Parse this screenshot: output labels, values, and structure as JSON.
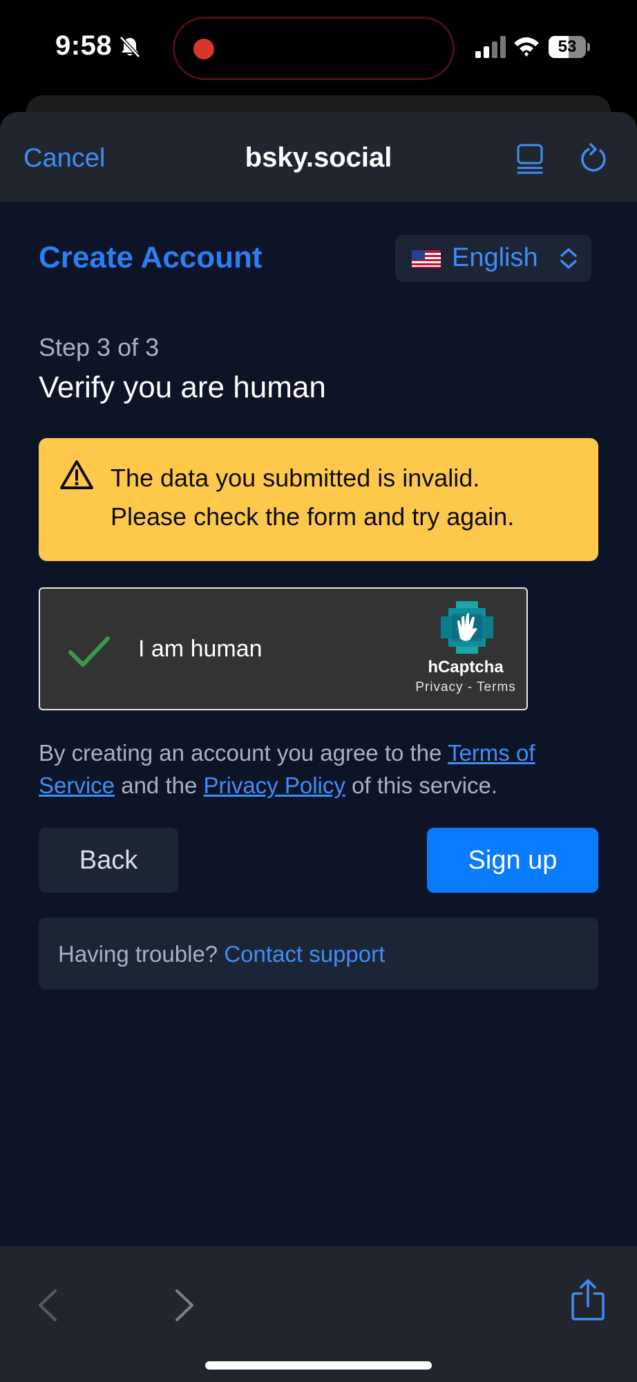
{
  "status_bar": {
    "time": "9:58",
    "battery_percent": "53",
    "battery_level": 0.53
  },
  "browser": {
    "cancel_label": "Cancel",
    "domain": "bsky.social"
  },
  "header": {
    "title": "Create Account",
    "language": "English"
  },
  "step": {
    "label": "Step 3 of 3",
    "heading": "Verify you are human"
  },
  "alert": {
    "line1": "The data you submitted is invalid.",
    "line2": "Please check the form and try again."
  },
  "captcha": {
    "label": "I am human",
    "brand": "hCaptcha",
    "links": "Privacy - Terms"
  },
  "terms": {
    "prefix": "By creating an account you agree to the ",
    "tos_link": "Terms of Service",
    "middle": " and the ",
    "privacy_link": "Privacy Policy",
    "suffix": " of this service."
  },
  "actions": {
    "back_label": "Back",
    "signup_label": "Sign up"
  },
  "trouble": {
    "text": "Having trouble? ",
    "link": "Contact support"
  },
  "colors": {
    "accent": "#2b7ff0",
    "primary_button": "#0a7aff",
    "alert_bg": "#fec84b",
    "page_bg": "#0e1428",
    "success_check": "#3a9a4a"
  }
}
